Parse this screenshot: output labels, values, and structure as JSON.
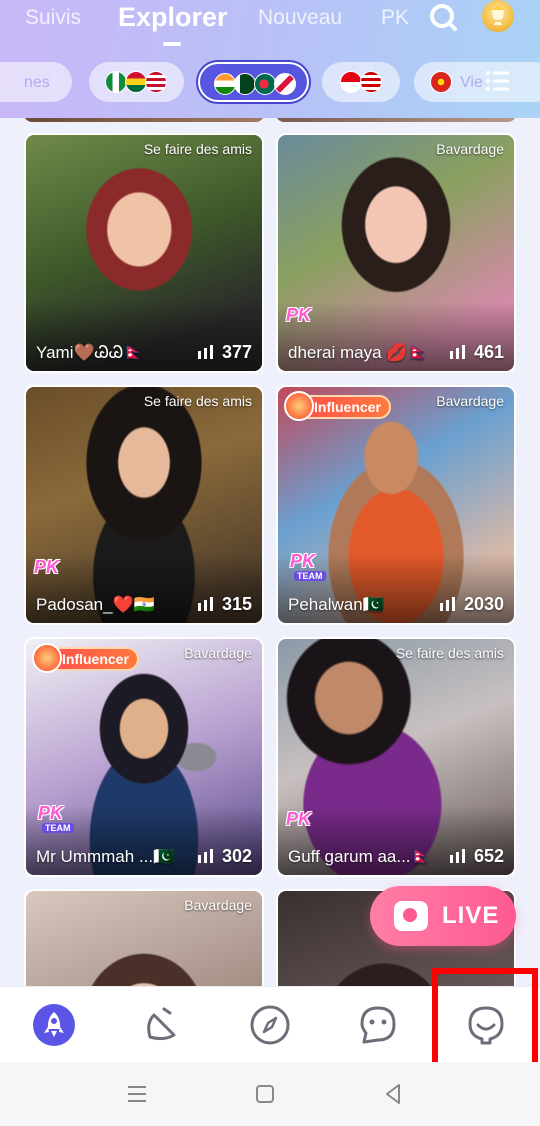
{
  "tabs": [
    {
      "label": "Suivis",
      "active": false
    },
    {
      "label": "Explorer",
      "active": true
    },
    {
      "label": "Nouveau",
      "active": false
    },
    {
      "label": "PK",
      "active": false
    }
  ],
  "header_icons": {
    "search": "search-icon",
    "ranking": "trophy-icon"
  },
  "countries": [
    {
      "label": "nes",
      "flags": [],
      "active": false
    },
    {
      "label": "",
      "flags": [
        "Nigeria",
        "Ghana",
        "United States"
      ],
      "active": false
    },
    {
      "label": "",
      "flags": [
        "India",
        "Pakistan",
        "Bangladesh",
        "Nepal"
      ],
      "active": true
    },
    {
      "label": "",
      "flags": [
        "Indonesia",
        "Malaysia"
      ],
      "active": false
    },
    {
      "label": "Vie",
      "flags": [
        "Vietnam"
      ],
      "active": false
    }
  ],
  "cards": [
    {
      "category": "Se faire des amis",
      "name": "Yami🤎ᏊᏊ🇳🇵",
      "viewers": "377",
      "badge": "none"
    },
    {
      "category": "Bavardage",
      "name": "dherai maya 💋🇳🇵",
      "viewers": "461",
      "badge": "pk"
    },
    {
      "category": "Se faire des amis",
      "name": "Padosan_❤️🇮🇳",
      "viewers": "315",
      "badge": "pk"
    },
    {
      "category": "Bavardage",
      "name": "Pehalwan🇵🇰",
      "viewers": "2030",
      "badge": "influencer",
      "influencer_label": "Influencer"
    },
    {
      "category": "Bavardage",
      "name": "Mr Ummmah ...🇵🇰",
      "viewers": "302",
      "badge": "influencer",
      "influencer_label": "Influencer"
    },
    {
      "category": "Se faire des amis",
      "name": "Guff garum aa...🇳🇵",
      "viewers": "652",
      "badge": "pk"
    },
    {
      "category": "Bavardage",
      "name": "",
      "viewers": "",
      "badge": "none"
    },
    {
      "category": "",
      "name": "",
      "viewers": "",
      "badge": "none"
    }
  ],
  "pk_badge_text": "PK",
  "pk_team_text": "TEAM",
  "live_button": {
    "label": "LIVE"
  },
  "bottom_nav": [
    {
      "icon": "rocket-icon",
      "active": true
    },
    {
      "icon": "party-hat-icon",
      "active": false
    },
    {
      "icon": "compass-icon",
      "active": false
    },
    {
      "icon": "chat-bubble-icon",
      "active": false
    },
    {
      "icon": "profile-icon",
      "active": false
    }
  ],
  "colors": {
    "accent": "#5656e0",
    "live": "#ff5a90",
    "highlight": "#ff0000"
  }
}
